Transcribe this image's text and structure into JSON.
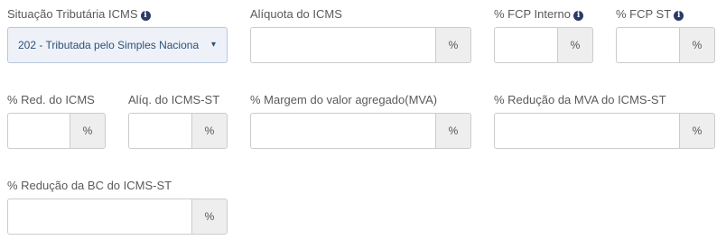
{
  "fields": {
    "situacao_tributaria": {
      "label": "Situação Tributária ICMS",
      "value": "202 - Tributada pelo Simples Naciona",
      "icon": "info-icon"
    },
    "aliquota_icms": {
      "label": "Alíquota do ICMS",
      "value": "",
      "unit": "%"
    },
    "fcp_interno": {
      "label": "% FCP Interno",
      "value": "",
      "unit": "%",
      "icon": "info-icon"
    },
    "fcp_st": {
      "label": "% FCP ST",
      "value": "",
      "unit": "%",
      "icon": "info-icon"
    },
    "red_icms": {
      "label": "% Red. do ICMS",
      "value": "",
      "unit": "%"
    },
    "aliq_icms_st": {
      "label": "Alíq. do ICMS-ST",
      "value": "",
      "unit": "%"
    },
    "margem_mva": {
      "label": "% Margem do valor agregado(MVA)",
      "value": "",
      "unit": "%"
    },
    "reducao_mva_st": {
      "label": "% Redução da MVA do ICMS-ST",
      "value": "",
      "unit": "%"
    },
    "reducao_bc_st": {
      "label": "% Redução da BC do ICMS-ST",
      "value": "",
      "unit": "%"
    }
  },
  "info_glyph": "i",
  "dropdown_glyph": "▾",
  "colors": {
    "label": "#5a5a5a",
    "info_icon": "#2b3a67",
    "select_bg": "#eef2f8",
    "select_text": "#2f4f78",
    "addon_bg": "#eeeeee",
    "border": "#cccccc"
  }
}
